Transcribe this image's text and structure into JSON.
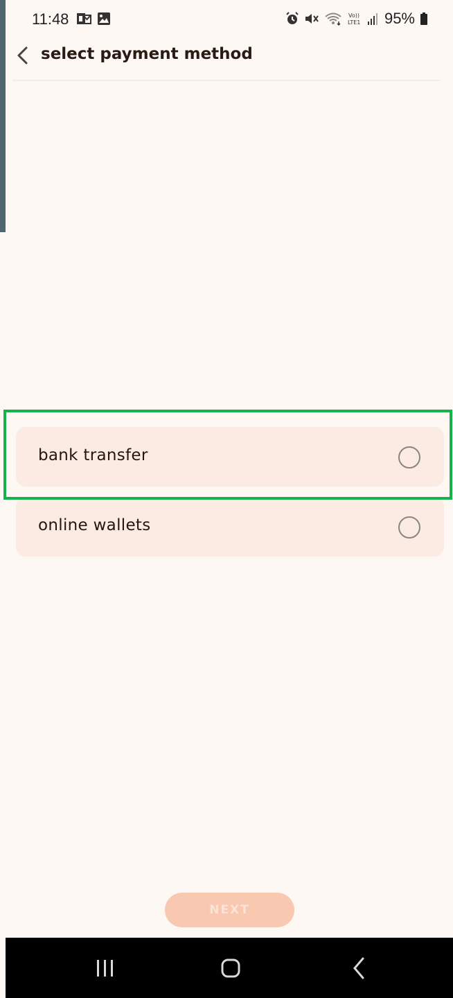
{
  "status_bar": {
    "time": "11:48",
    "battery": "95%",
    "left_icons": [
      "outlook-icon",
      "image-icon"
    ],
    "right_icons": [
      "alarm-icon",
      "mute-icon",
      "wifi-icon",
      "volte-icon",
      "signal-icon",
      "battery-icon"
    ],
    "volte_label": "Vo)) LTE1"
  },
  "header": {
    "title": "select payment method",
    "back_icon": "chevron-left-icon"
  },
  "payment_options": [
    {
      "label": "bank transfer",
      "selected": false,
      "highlighted": true
    },
    {
      "label": "online wallets",
      "selected": false,
      "highlighted": false
    }
  ],
  "next_button": {
    "label": "NEXT",
    "enabled": false
  },
  "nav_bar": {
    "recents_icon": "recents-icon",
    "home_icon": "home-icon",
    "back_icon": "back-icon"
  },
  "colors": {
    "background": "#fdf8f4",
    "option_bg": "#fcebe3",
    "highlight": "#12b34a",
    "next_disabled": "#f9c8b1",
    "title": "#2a1a14"
  }
}
